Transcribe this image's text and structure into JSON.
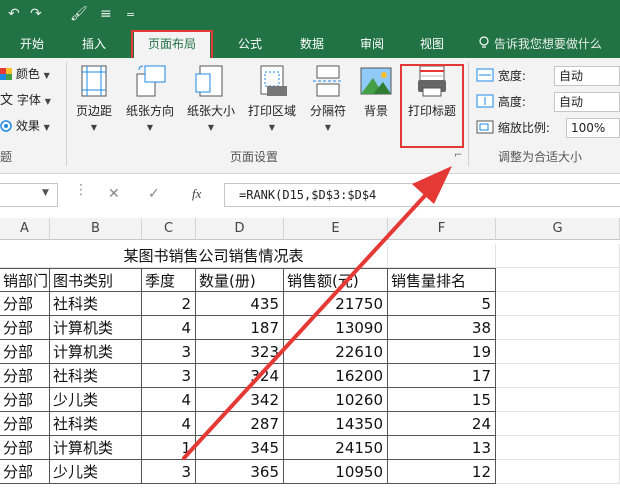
{
  "qat": {
    "undo": "↶",
    "redo": "↷",
    "brush": "🖌",
    "pin": "≡",
    "more": "="
  },
  "tabs": {
    "start": "开始",
    "insert": "插入",
    "layout": "页面布局",
    "formula": "公式",
    "data": "数据",
    "review": "审阅",
    "view": "视图"
  },
  "tell_me": "告诉我您想要做什么",
  "ribbon": {
    "theme": {
      "colors": "颜色",
      "fonts": "字体",
      "effects": "效果",
      "group": "题"
    },
    "page_setup": {
      "margins": "页边距",
      "orientation": "纸张方向",
      "size": "纸张大小",
      "print_area": "打印区域",
      "breaks": "分隔符",
      "background": "背景",
      "print_titles": "打印标题",
      "group": "页面设置",
      "launcher": "⌐"
    },
    "scale": {
      "width_label": "宽度:",
      "width_value": "自动",
      "height_label": "高度:",
      "height_value": "自动",
      "scale_label": "缩放比例:",
      "scale_value": "100%",
      "group": "调整为合适大小"
    }
  },
  "formula_bar": {
    "cancel": "✕",
    "enter": "✓",
    "fx": "fx",
    "formula": "=RANK(D15,$D$3:$D$4"
  },
  "columns": [
    "A",
    "B",
    "C",
    "D",
    "E",
    "F",
    "G"
  ],
  "sheet": {
    "title": "某图书销售公司销售情况表",
    "headers": [
      "销部门",
      "图书类别",
      "季度",
      "数量(册)",
      "销售额(元)",
      "销售量排名"
    ],
    "rows": [
      [
        "分部",
        "社科类",
        "2",
        "435",
        "21750",
        "5"
      ],
      [
        "分部",
        "计算机类",
        "4",
        "187",
        "13090",
        "38"
      ],
      [
        "分部",
        "计算机类",
        "3",
        "323",
        "22610",
        "19"
      ],
      [
        "分部",
        "社科类",
        "3",
        "324",
        "16200",
        "17"
      ],
      [
        "分部",
        "少儿类",
        "4",
        "342",
        "10260",
        "15"
      ],
      [
        "分部",
        "社科类",
        "4",
        "287",
        "14350",
        "24"
      ],
      [
        "分部",
        "计算机类",
        "1",
        "345",
        "24150",
        "13"
      ],
      [
        "分部",
        "少儿类",
        "3",
        "365",
        "10950",
        "12"
      ]
    ]
  },
  "colors": {
    "excel_green": "#217346",
    "highlight": "#e53935",
    "arrow": "#e53935"
  }
}
